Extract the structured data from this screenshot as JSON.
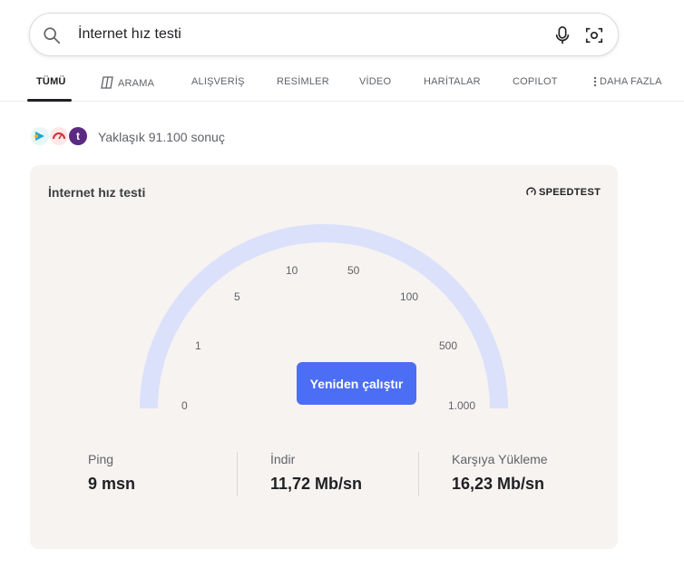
{
  "search": {
    "query": "İnternet hız testi",
    "search_icon": "search-icon",
    "mic_icon": "microphone-icon",
    "visual_icon": "visual-search-icon"
  },
  "tabs": [
    {
      "label": "TÜMÜ",
      "active": true
    },
    {
      "label": "ARAMA",
      "icon": "copilot-search-icon"
    },
    {
      "label": "ALIŞVERİŞ"
    },
    {
      "label": "RESİMLER"
    },
    {
      "label": "VİDEO"
    },
    {
      "label": "HARİTALAR"
    },
    {
      "label": "COPILOT"
    },
    {
      "label": "DAHA FAZLA",
      "icon": "more-vertical-icon"
    }
  ],
  "results": {
    "count_text": "Yaklaşık 91.100 sonuç",
    "favicon_3_letter": "t"
  },
  "speedtest": {
    "title": "İnternet hız testi",
    "brand": "SPEEDTEST",
    "gauge_labels": [
      "0",
      "1",
      "5",
      "10",
      "50",
      "100",
      "500",
      "1.000"
    ],
    "rerun_label": "Yeniden çalıştır",
    "stats": [
      {
        "label": "Ping",
        "value": "9 msn"
      },
      {
        "label": "İndir",
        "value": "11,72 Mb/sn"
      },
      {
        "label": "Karşıya Yükleme",
        "value": "16,23 Mb/sn"
      }
    ]
  },
  "colors": {
    "accent_button": "#4c6ef5",
    "gauge_track": "#dbe0fb",
    "card_background": "#f6f3f1"
  }
}
